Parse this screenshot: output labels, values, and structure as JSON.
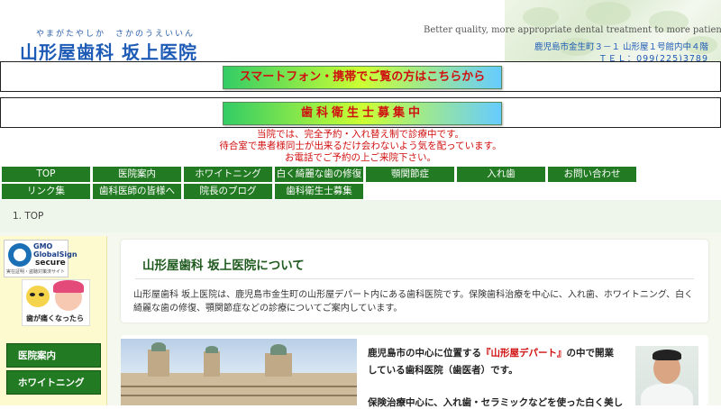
{
  "header": {
    "furigana": "やまがたやしか　さかのうえいいん",
    "title": "山形屋歯科 坂上医院",
    "tagline": "Better quality, more appropriate dental treatment to more patients",
    "address": "鹿児島市金生町３－１ 山形屋１号館内中４階",
    "tel": "ＴＥＬ：099(225)3789"
  },
  "banners": {
    "smartphone": "スマートフォン・携帯でご覧の方はこちらから",
    "recruit": "歯科衛生士募集中"
  },
  "notice": [
    "当院では、完全予約・入れ替え制で診療中です。",
    "待合室で患者様同士が出来るだけ会わないよう気を配っています。",
    "お電話でご予約の上ご来院下さい。"
  ],
  "nav": [
    "TOP",
    "医院案内",
    "ホワイトニング",
    "白く綺麗な歯の修復",
    "顎関節症",
    "入れ歯",
    "お問い合わせ",
    "リンク集",
    "歯科医師の皆様へ",
    "院長のブログ",
    "歯科衛生士募集"
  ],
  "breadcrumb": "1. TOP",
  "sidebar": {
    "seal_brand": "GMO",
    "seal_name": "GlobalSign",
    "seal_secure": "secure",
    "seal_sub": "実在証明・盗聴対策済サイト",
    "toothache_caption": "歯が痛くなったら",
    "items": [
      "医院案内",
      "ホワイトニング"
    ]
  },
  "about": {
    "title": "山形屋歯科 坂上医院について",
    "text": "山形屋歯科 坂上医院は、鹿児島市金生町の山形屋デパート内にある歯科医院です。保険歯科治療を中心に、入れ歯、ホワイトニング、白く綺麗な歯の修復、顎関節症などの診療についてご案内しています。"
  },
  "intro": {
    "line1_pre": "鹿児島市の中心に位置する",
    "line1_em": "『山形屋デパート』",
    "line1_post": "の中で開業",
    "line2": "している歯科医院（歯医者）です。",
    "line3": "保険治療中心に、入れ歯・セラミックなどを使った白く美し"
  },
  "colors": {
    "nav_green": "#227a22",
    "title_blue": "#1e5bb6",
    "notice_red": "#d01010",
    "sidebar_yellow": "#fdfad0"
  }
}
